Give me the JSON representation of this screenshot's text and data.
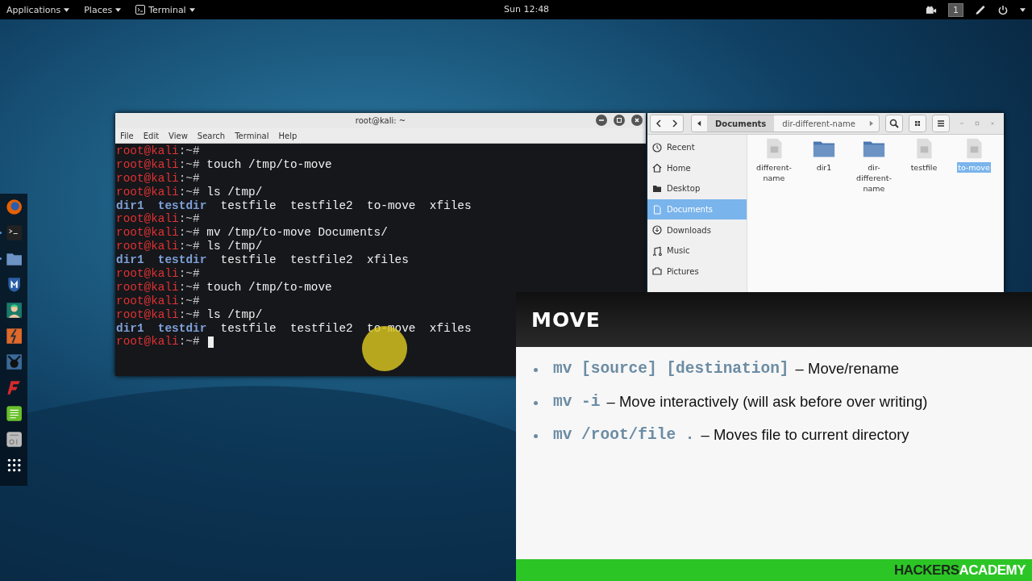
{
  "top_bar": {
    "menus": [
      {
        "label": "Applications",
        "icon": false
      },
      {
        "label": "Places",
        "icon": false
      },
      {
        "label": "Terminal",
        "icon": true
      }
    ],
    "clock": "Sun 12:48",
    "workspace": "1"
  },
  "dock": {
    "apps": [
      {
        "kind": "firefox",
        "running": false
      },
      {
        "kind": "terminal",
        "running": true
      },
      {
        "kind": "files",
        "running": true
      },
      {
        "kind": "shield",
        "running": false
      },
      {
        "kind": "figure",
        "running": false
      },
      {
        "kind": "burp",
        "running": false
      },
      {
        "kind": "beef",
        "running": false
      },
      {
        "kind": "faraday",
        "running": false
      },
      {
        "kind": "notes",
        "running": false
      },
      {
        "kind": "gear",
        "running": false
      },
      {
        "kind": "grid",
        "running": false
      }
    ]
  },
  "terminal": {
    "title": "root@kali: ~",
    "menu": [
      "File",
      "Edit",
      "View",
      "Search",
      "Terminal",
      "Help"
    ],
    "lines": [
      {
        "kind": "prompt",
        "user": "root@kali",
        "path": ":~#"
      },
      {
        "kind": "prompt",
        "user": "root@kali",
        "path": ":~#",
        "command": "touch /tmp/to-move"
      },
      {
        "kind": "prompt",
        "user": "root@kali",
        "path": ":~#"
      },
      {
        "kind": "prompt",
        "user": "root@kali",
        "path": ":~#",
        "command": "ls /tmp/"
      },
      {
        "kind": "output",
        "items": [
          {
            "name": "dir1",
            "kind": "dir"
          },
          {
            "name": "testdir",
            "kind": "dir"
          },
          {
            "name": "testfile",
            "kind": "file"
          },
          {
            "name": "testfile2",
            "kind": "file"
          },
          {
            "name": "to-move",
            "kind": "file"
          },
          {
            "name": "xfiles",
            "kind": "file"
          }
        ]
      },
      {
        "kind": "prompt",
        "user": "root@kali",
        "path": ":~#"
      },
      {
        "kind": "prompt",
        "user": "root@kali",
        "path": ":~#",
        "command": "mv /tmp/to-move Documents/"
      },
      {
        "kind": "prompt",
        "user": "root@kali",
        "path": ":~#",
        "command": "ls /tmp/"
      },
      {
        "kind": "output",
        "items": [
          {
            "name": "dir1",
            "kind": "dir"
          },
          {
            "name": "testdir",
            "kind": "dir"
          },
          {
            "name": "testfile",
            "kind": "file"
          },
          {
            "name": "testfile2",
            "kind": "file"
          },
          {
            "name": "xfiles",
            "kind": "file"
          }
        ]
      },
      {
        "kind": "prompt",
        "user": "root@kali",
        "path": ":~#"
      },
      {
        "kind": "prompt",
        "user": "root@kali",
        "path": ":~#",
        "command": "touch /tmp/to-move"
      },
      {
        "kind": "prompt",
        "user": "root@kali",
        "path": ":~#"
      },
      {
        "kind": "prompt",
        "user": "root@kali",
        "path": ":~#",
        "command": "ls /tmp/"
      },
      {
        "kind": "output",
        "items": [
          {
            "name": "dir1",
            "kind": "dir"
          },
          {
            "name": "testdir",
            "kind": "dir"
          },
          {
            "name": "testfile",
            "kind": "file"
          },
          {
            "name": "testfile2",
            "kind": "file"
          },
          {
            "name": "to-move",
            "kind": "file"
          },
          {
            "name": "xfiles",
            "kind": "file"
          }
        ]
      },
      {
        "kind": "prompt",
        "user": "root@kali",
        "path": ":~#",
        "cursor": true
      }
    ]
  },
  "file_manager": {
    "path": [
      {
        "label": "Documents",
        "selected": true
      },
      {
        "label": "dir-different-name",
        "selected": false
      }
    ],
    "sidebar": [
      {
        "label": "Recent",
        "selected": false
      },
      {
        "label": "Home",
        "selected": false
      },
      {
        "label": "Desktop",
        "selected": false
      },
      {
        "label": "Documents",
        "selected": true
      },
      {
        "label": "Downloads",
        "selected": false
      },
      {
        "label": "Music",
        "selected": false
      },
      {
        "label": "Pictures",
        "selected": false
      }
    ],
    "files": [
      {
        "name": "different-name",
        "kind": "file",
        "selected": false
      },
      {
        "name": "dir1",
        "kind": "folder",
        "selected": false
      },
      {
        "name": "dir-different-name",
        "kind": "folder",
        "selected": false
      },
      {
        "name": "testfile",
        "kind": "file",
        "selected": false
      },
      {
        "name": "to-move",
        "kind": "file",
        "selected": true
      }
    ]
  },
  "slide": {
    "title": "MOVE",
    "bullets": [
      {
        "code": "mv [source] [destination]",
        "text": "– Move/rename"
      },
      {
        "code": "mv -i",
        "text": "– Move interactively (will ask before over writing)"
      },
      {
        "code": "mv /root/file .",
        "text": "– Moves file to current directory"
      }
    ],
    "logo": {
      "first": "HACKERS",
      "second": "ACADEMY"
    }
  }
}
